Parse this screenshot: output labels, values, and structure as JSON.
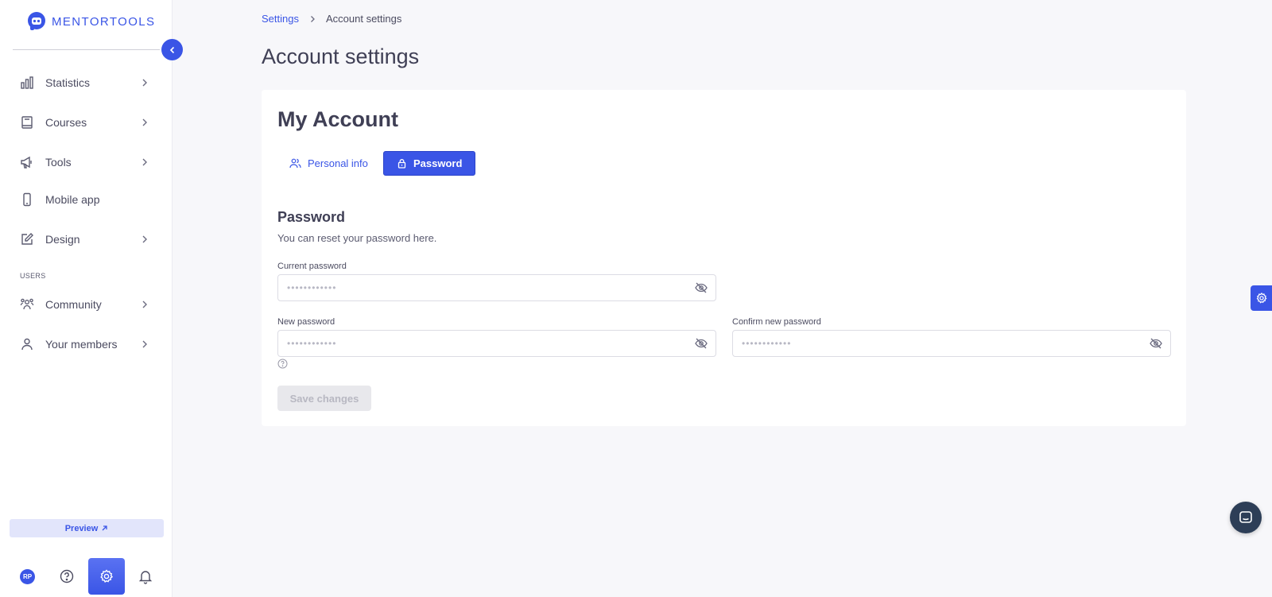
{
  "brand": {
    "name": "MENTORTOOLS",
    "accent": "#3a55e6"
  },
  "sidebar": {
    "items": [
      {
        "label": "Statistics",
        "icon": "bar-chart-icon",
        "has_submenu": true
      },
      {
        "label": "Courses",
        "icon": "book-icon",
        "has_submenu": true
      },
      {
        "label": "Tools",
        "icon": "megaphone-icon",
        "has_submenu": true
      },
      {
        "label": "Mobile app",
        "icon": "phone-icon",
        "has_submenu": false
      },
      {
        "label": "Design",
        "icon": "pencil-icon",
        "has_submenu": true
      }
    ],
    "section_users": "USERS",
    "user_items": [
      {
        "label": "Community",
        "icon": "community-icon",
        "has_submenu": true
      },
      {
        "label": "Your members",
        "icon": "user-icon",
        "has_submenu": true
      }
    ],
    "preview_label": "Preview",
    "avatar_initials": "RP"
  },
  "breadcrumb": {
    "parent": "Settings",
    "current": "Account settings"
  },
  "page_title": "Account settings",
  "card": {
    "title": "My Account",
    "tabs": [
      {
        "label": "Personal info",
        "icon": "users-icon",
        "active": false
      },
      {
        "label": "Password",
        "icon": "lock-icon",
        "active": true
      }
    ],
    "section_title": "Password",
    "section_desc": "You can reset your password here.",
    "fields": {
      "current": {
        "label": "Current password",
        "placeholder": "••••••••••••"
      },
      "new": {
        "label": "New password",
        "placeholder": "••••••••••••"
      },
      "confirm": {
        "label": "Confirm new password",
        "placeholder": "••••••••••••"
      }
    },
    "save_label": "Save changes"
  }
}
